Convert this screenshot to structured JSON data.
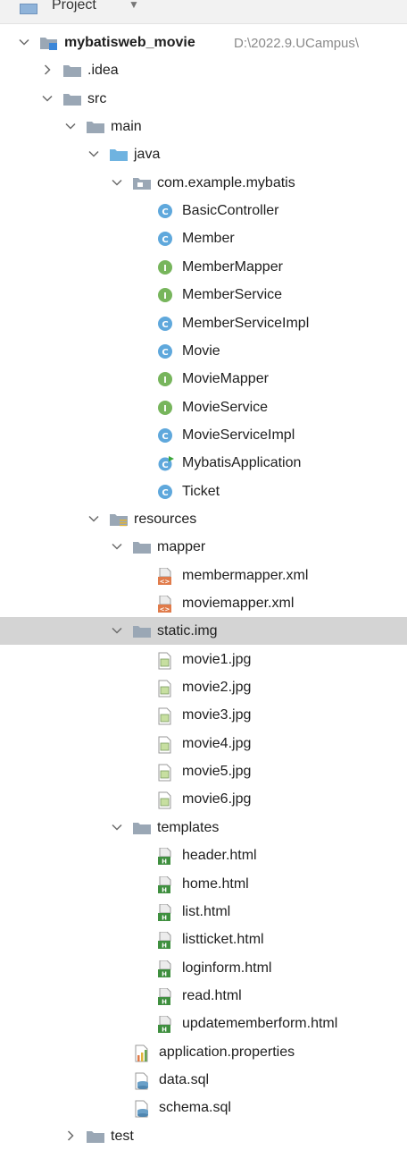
{
  "header": {
    "title": "Project"
  },
  "tree": [
    {
      "label": "mybatisweb_movie",
      "icon": "module-folder-icon",
      "depth": 0,
      "chevron": "expanded",
      "bold": true,
      "path": "D:\\2022.9.UCampus\\"
    },
    {
      "label": ".idea",
      "icon": "folder-icon",
      "depth": 1,
      "chevron": "collapsed"
    },
    {
      "label": "src",
      "icon": "folder-icon",
      "depth": 1,
      "chevron": "expanded"
    },
    {
      "label": "main",
      "icon": "folder-icon",
      "depth": 2,
      "chevron": "expanded"
    },
    {
      "label": "java",
      "icon": "source-folder-icon",
      "depth": 3,
      "chevron": "expanded"
    },
    {
      "label": "com.example.mybatis",
      "icon": "package-icon",
      "depth": 4,
      "chevron": "expanded"
    },
    {
      "label": "BasicController",
      "icon": "class-icon",
      "depth": 5
    },
    {
      "label": "Member",
      "icon": "class-icon",
      "depth": 5
    },
    {
      "label": "MemberMapper",
      "icon": "interface-icon",
      "depth": 5
    },
    {
      "label": "MemberService",
      "icon": "interface-icon",
      "depth": 5
    },
    {
      "label": "MemberServiceImpl",
      "icon": "class-icon",
      "depth": 5
    },
    {
      "label": "Movie",
      "icon": "class-icon",
      "depth": 5
    },
    {
      "label": "MovieMapper",
      "icon": "interface-icon",
      "depth": 5
    },
    {
      "label": "MovieService",
      "icon": "interface-icon",
      "depth": 5
    },
    {
      "label": "MovieServiceImpl",
      "icon": "class-icon",
      "depth": 5
    },
    {
      "label": "MybatisApplication",
      "icon": "spring-boot-class-icon",
      "depth": 5
    },
    {
      "label": "Ticket",
      "icon": "class-icon",
      "depth": 5
    },
    {
      "label": "resources",
      "icon": "resources-folder-icon",
      "depth": 3,
      "chevron": "expanded"
    },
    {
      "label": "mapper",
      "icon": "folder-icon",
      "depth": 4,
      "chevron": "expanded"
    },
    {
      "label": "membermapper.xml",
      "icon": "xml-file-icon",
      "depth": 5
    },
    {
      "label": "moviemapper.xml",
      "icon": "xml-file-icon",
      "depth": 5
    },
    {
      "label": "static.img",
      "icon": "folder-icon",
      "depth": 4,
      "chevron": "expanded",
      "selected": true
    },
    {
      "label": "movie1.jpg",
      "icon": "image-file-icon",
      "depth": 5
    },
    {
      "label": "movie2.jpg",
      "icon": "image-file-icon",
      "depth": 5
    },
    {
      "label": "movie3.jpg",
      "icon": "image-file-icon",
      "depth": 5
    },
    {
      "label": "movie4.jpg",
      "icon": "image-file-icon",
      "depth": 5
    },
    {
      "label": "movie5.jpg",
      "icon": "image-file-icon",
      "depth": 5
    },
    {
      "label": "movie6.jpg",
      "icon": "image-file-icon",
      "depth": 5
    },
    {
      "label": "templates",
      "icon": "folder-icon",
      "depth": 4,
      "chevron": "expanded"
    },
    {
      "label": "header.html",
      "icon": "html-file-icon",
      "depth": 5
    },
    {
      "label": "home.html",
      "icon": "html-file-icon",
      "depth": 5
    },
    {
      "label": "list.html",
      "icon": "html-file-icon",
      "depth": 5
    },
    {
      "label": "listticket.html",
      "icon": "html-file-icon",
      "depth": 5
    },
    {
      "label": "loginform.html",
      "icon": "html-file-icon",
      "depth": 5
    },
    {
      "label": "read.html",
      "icon": "html-file-icon",
      "depth": 5
    },
    {
      "label": "updatememberform.html",
      "icon": "html-file-icon",
      "depth": 5
    },
    {
      "label": "application.properties",
      "icon": "properties-file-icon",
      "depth": 4
    },
    {
      "label": "data.sql",
      "icon": "sql-file-icon",
      "depth": 4
    },
    {
      "label": "schema.sql",
      "icon": "sql-file-icon",
      "depth": 4
    },
    {
      "label": "test",
      "icon": "folder-icon",
      "depth": 2,
      "chevron": "collapsed"
    }
  ],
  "colors": {
    "folder": "#9aa7b5",
    "source_folder": "#6fb3e0",
    "class": "#5fa8dc",
    "interface": "#77b55c",
    "xml": "#e07b4a",
    "html": "#3f8f3f",
    "selection": "#d4d4d4"
  }
}
